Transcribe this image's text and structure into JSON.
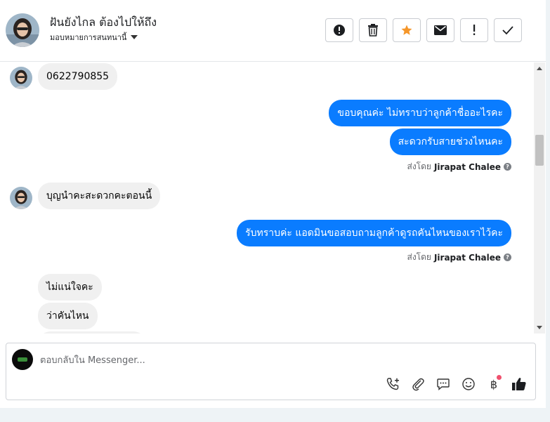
{
  "header": {
    "contact_name": "ฝันยังไกล ต้องไปให้ถึง",
    "assign_label": "มอบหมายการสนทนานี้",
    "actions": [
      {
        "name": "spam-button",
        "icon": "alert-circle-icon"
      },
      {
        "name": "delete-button",
        "icon": "trash-icon"
      },
      {
        "name": "star-button",
        "icon": "star-icon",
        "color": "#f5962a"
      },
      {
        "name": "mark-unread-button",
        "icon": "envelope-icon"
      },
      {
        "name": "follow-up-button",
        "icon": "exclamation-icon"
      },
      {
        "name": "mark-done-button",
        "icon": "check-icon"
      }
    ]
  },
  "messages": {
    "m1": "0622790855",
    "m2": "ขอบคุณค่ะ ไม่ทราบว่าลูกค้าชื่ออะไรคะ",
    "m3": "สะดวกรับสายช่วงไหนคะ",
    "m4": "บุญนำคะสะดวกคะตอนนี้",
    "m5": "รับทราบค่ะ แอดมินขอสอบถามลูกค้าดูรถคันไหนของเราไว้คะ",
    "m6": "ไม่แน่ใจคะ",
    "m7": "ว่าคันไหน",
    "sent_by_prefix": "ส่งโดย",
    "sent_by_name": "Jirapat Chalee"
  },
  "composer": {
    "placeholder": "ตอบกลับใน Messenger...",
    "currency_symbol": "฿"
  },
  "colors": {
    "outgoing_bubble": "#0a7cff",
    "incoming_bubble": "#f0f0f0",
    "notification_dot": "#f0506e"
  }
}
